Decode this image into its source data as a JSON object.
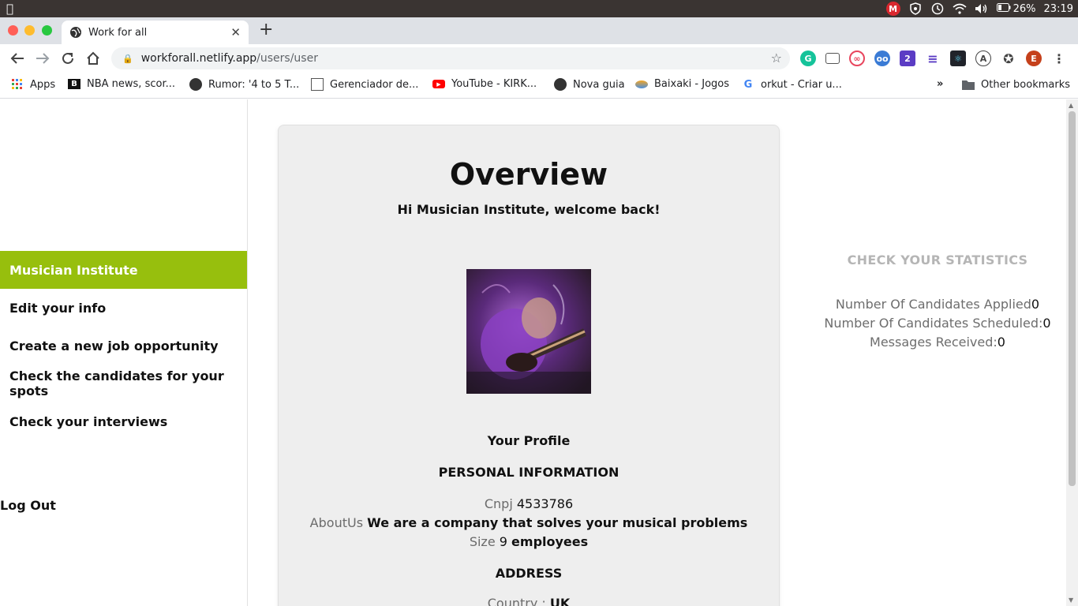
{
  "system_bar": {
    "battery": "26%",
    "clock": "23:19",
    "icons": [
      "apple-icon",
      "mega-icon",
      "shield-icon",
      "time-machine-icon",
      "wifi-icon",
      "volume-icon",
      "battery-icon"
    ]
  },
  "browser": {
    "tab_title": "Work for all",
    "url_host": "workforall.netlify.app",
    "url_path": "/users/user",
    "profile_initial": "E"
  },
  "bookmarks": {
    "items": [
      {
        "label": "Apps",
        "icon": "apps-grid-icon"
      },
      {
        "label": "NBA news, scor...",
        "icon": "bleacher-report-icon"
      },
      {
        "label": "Rumor: '4 to 5 T...",
        "icon": "globe-icon"
      },
      {
        "label": "Gerenciador de...",
        "icon": "photo-manager-icon"
      },
      {
        "label": "YouTube - KIRK...",
        "icon": "youtube-icon"
      },
      {
        "label": "Nova guia",
        "icon": "globe-icon"
      },
      {
        "label": "Baixaki - Jogos",
        "icon": "baixaki-icon"
      },
      {
        "label": "orkut - Criar u...",
        "icon": "google-icon"
      }
    ],
    "overflow": "»",
    "other": "Other bookmarks"
  },
  "sidebar": {
    "items": [
      {
        "label": "Musician Institute",
        "active": true
      },
      {
        "label": "Edit your info",
        "active": false
      },
      {
        "label": "Create a new job opportunity",
        "active": false
      },
      {
        "label": "Check the candidates for your spots",
        "active": false
      },
      {
        "label": "Check your interviews",
        "active": false
      }
    ],
    "logout": "Log Out"
  },
  "overview": {
    "title": "Overview",
    "welcome": "Hi Musician Institute, welcome back!",
    "profile_heading": "Your Profile",
    "personal_heading": "PERSONAL INFORMATION",
    "cnpj_label": "Cnpj",
    "cnpj_value": "4533786",
    "about_label": "AboutUs",
    "about_value": "We are a company that solves your musical problems",
    "size_label": "Size",
    "size_value": "9",
    "size_unit": "employees",
    "address_heading": "ADDRESS",
    "country_label": "Country :",
    "country_value": "UK"
  },
  "stats": {
    "title": "CHECK YOUR STATISTICS",
    "applied_label": "Number Of Candidates Applied",
    "applied_value": "0",
    "scheduled_label": "Number Of Candidates Scheduled:",
    "scheduled_value": "0",
    "messages_label": "Messages Received:",
    "messages_value": "0"
  },
  "colors": {
    "accent": "#97bf0d",
    "card_bg": "#eeeeee",
    "muted": "#6b6b6b"
  }
}
